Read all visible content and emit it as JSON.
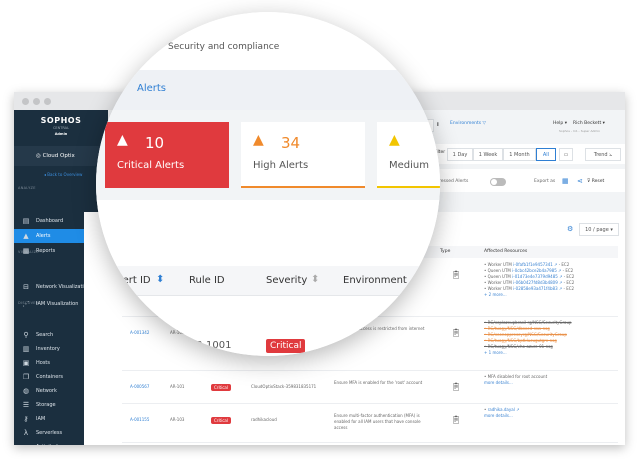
{
  "sidebar": {
    "brand": "SOPHOS",
    "product": "CENTRAL",
    "role": "Admin",
    "workspace": "Cloud Optix",
    "back": "◂ Back to Overview",
    "sections": {
      "analyze": "ANALYZE",
      "visualize": "VISUALIZE",
      "discover": "DISCOVER"
    },
    "items": [
      {
        "label": "Dashboard",
        "icon": "▤"
      },
      {
        "label": "Alerts",
        "icon": "▲"
      },
      {
        "label": "Reports",
        "icon": "▦"
      },
      {
        "label": "Network Visualization",
        "icon": "⊟"
      },
      {
        "label": "IAM Visualization",
        "icon": "⋰"
      },
      {
        "label": "Search",
        "icon": "⚲"
      },
      {
        "label": "Inventory",
        "icon": "▥"
      },
      {
        "label": "Hosts",
        "icon": "▣"
      },
      {
        "label": "Containers",
        "icon": "❐"
      },
      {
        "label": "Network",
        "icon": "◍"
      },
      {
        "label": "Storage",
        "icon": "☰"
      },
      {
        "label": "IAM",
        "icon": "⚷"
      },
      {
        "label": "Serverless",
        "icon": "λ"
      },
      {
        "label": "Activity Logs",
        "icon": "▬"
      }
    ]
  },
  "header": {
    "subtitle": "Security and compliance",
    "breadcrumb_sep": "/",
    "breadcrumb": "Alerts",
    "environments": "Environments ▽",
    "help": "Help ▾",
    "user": "Rich Beckett ▾",
    "user_sub": "Sophos - Int... Super Admin",
    "info": "i"
  },
  "summary": [
    {
      "count": "10",
      "label": "Critical Alerts",
      "color": "#e03a3e"
    },
    {
      "count": "34",
      "label": "High Alerts",
      "color": "#f08a2c"
    },
    {
      "count": "",
      "label": "Medium",
      "color": "#f2c500"
    }
  ],
  "filters": {
    "label": "Filter by:",
    "options": [
      "1 Day",
      "1 Week",
      "1 Month",
      "All"
    ],
    "selected": "All",
    "calendar": "▭",
    "trend": "Trend ⦣"
  },
  "toolbar": {
    "suppressed": "Show Suppressed Alerts",
    "export": "Export as",
    "reset": "⊽ Reset",
    "per_page": "10 / page ▾"
  },
  "table": {
    "columns": [
      "Alert ID",
      "Rule ID",
      "Severity",
      "Environment",
      "Type",
      "Affected Resources"
    ],
    "rows": [
      {
        "id": "",
        "rule": "",
        "severity": "",
        "env": "",
        "desc": "...any",
        "resources": [
          [
            "Worker UTM ",
            "i-0fafb1f1e9457341 ↗",
            " - EC2"
          ],
          [
            "Queen UTM ",
            "i-0cbc42bce2b4a7985 ↗",
            " - EC2"
          ],
          [
            "Queen UTM ",
            "i-01d73e4e7379d9485 ↗",
            " - EC2"
          ],
          [
            "Worker UTM ",
            "i-06b0427fd8d3b4809 ↗",
            " - EC2"
          ],
          [
            "Worker UTM ",
            "i-02858e93a471f4b83 ↗",
            " - EC2"
          ]
        ],
        "more": "+ 2 more..."
      },
      {
        "id": "A-001342",
        "rule": "AR-1001",
        "severity": "Critical",
        "env": "",
        "desc": "Ensure SSH access is restricted from internet",
        "resources": [
          [
            "RG/seplazeupbrasil-rg/NSG/SecurityGroup"
          ],
          [
            "RG/tuogy/NSG/dbseed-ssw-nsg"
          ],
          [
            "RG/seonoppreseyrg/NSG/SecurityGroup"
          ],
          [
            "RG/tuogy/NSG/bptklucugutgre-nsg"
          ],
          [
            "RG/tuogy/NSG/vho-azure-01-nsg"
          ]
        ],
        "more": "+ 1 more..."
      },
      {
        "id": "A-000567",
        "rule": "AR-101",
        "severity": "Critical",
        "env": "CloudOptixStack-359831835171",
        "desc": "Ensure MFA is enabled for the 'root' account",
        "resources": [
          [
            "MFA disabled for root account"
          ]
        ],
        "more": "more details..."
      },
      {
        "id": "A-001155",
        "rule": "AR-103",
        "severity": "Critical",
        "env": "radhikacloud",
        "desc": "Ensure multi-factor authentication (MFA) is enabled for all IAM users that have console access",
        "resources": [
          [
            "",
            "radhika.dayal ↗",
            ""
          ]
        ],
        "more": "more details..."
      }
    ]
  }
}
